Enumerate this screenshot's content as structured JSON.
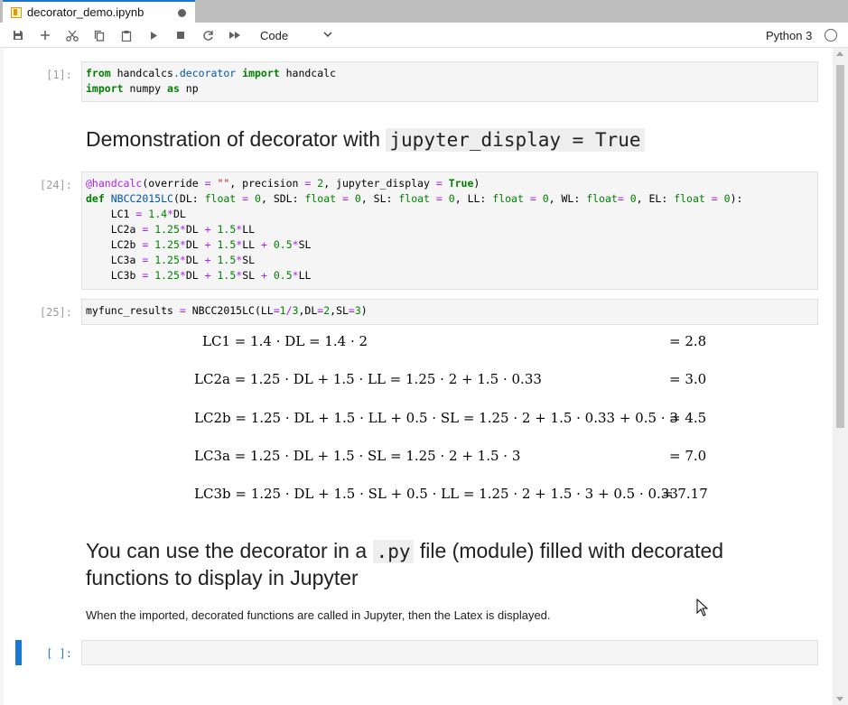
{
  "tab": {
    "title": "decorator_demo.ipynb"
  },
  "toolbar": {
    "cell_type": "Code",
    "kernel_name": "Python 3",
    "icons": [
      "save-icon",
      "add-cell-icon",
      "cut-icon",
      "copy-icon",
      "paste-icon",
      "run-icon",
      "stop-icon",
      "restart-icon",
      "fast-forward-icon"
    ]
  },
  "cells": [
    {
      "prompt": "[1]:",
      "lines": [
        "from handcalcs.decorator import handcalc",
        "import numpy as np"
      ]
    },
    {
      "markdown_heading": "Demonstration of decorator with",
      "markdown_code": "jupyter_display = True"
    },
    {
      "prompt": "[24]:",
      "lines": [
        "@handcalc(override = \"\", precision = 2, jupyter_display = True)",
        "def NBCC2015LC(DL: float = 0, SDL: float = 0, SL: float = 0, LL: float = 0, WL: float= 0, EL: float = 0):",
        "    LC1 = 1.4*DL",
        "    LC2a = 1.25*DL + 1.5*LL",
        "    LC2b = 1.25*DL + 1.5*LL + 0.5*SL",
        "    LC3a = 1.25*DL + 1.5*SL",
        "    LC3b = 1.25*DL + 1.5*SL + 0.5*LL"
      ]
    },
    {
      "prompt": "[25]:",
      "lines": [
        "myfunc_results = NBCC2015LC(LL=1/3,DL=2,SL=3)"
      ]
    }
  ],
  "output_math": [
    {
      "lhs": "LC1 = 1.4 · DL = 1.4 · 2",
      "rhs": "= 2.8"
    },
    {
      "lhs": "LC2a = 1.25 · DL + 1.5 · LL = 1.25 · 2 + 1.5 · 0.33",
      "rhs": "= 3.0"
    },
    {
      "lhs": "LC2b = 1.25 · DL + 1.5 · LL + 0.5 · SL = 1.25 · 2 + 1.5 · 0.33 + 0.5 · 3",
      "rhs": "= 4.5"
    },
    {
      "lhs": "LC3a = 1.25 · DL + 1.5 · SL = 1.25 · 2 + 1.5 · 3",
      "rhs": "= 7.0"
    },
    {
      "lhs": "LC3b = 1.25 · DL + 1.5 · SL + 0.5 · LL = 1.25 · 2 + 1.5 · 3 + 0.5 · 0.33",
      "rhs": "= 7.17"
    }
  ],
  "markdown2": {
    "pre": "You can use the decorator in a",
    "code": ".py",
    "post_line1": "file (module) filled with decorated",
    "line2": "functions to display in Jupyter",
    "paragraph": "When the imported, decorated functions are called in Jupyter, then the Latex is displayed."
  },
  "empty_cell": {
    "prompt": "[ ]:"
  }
}
